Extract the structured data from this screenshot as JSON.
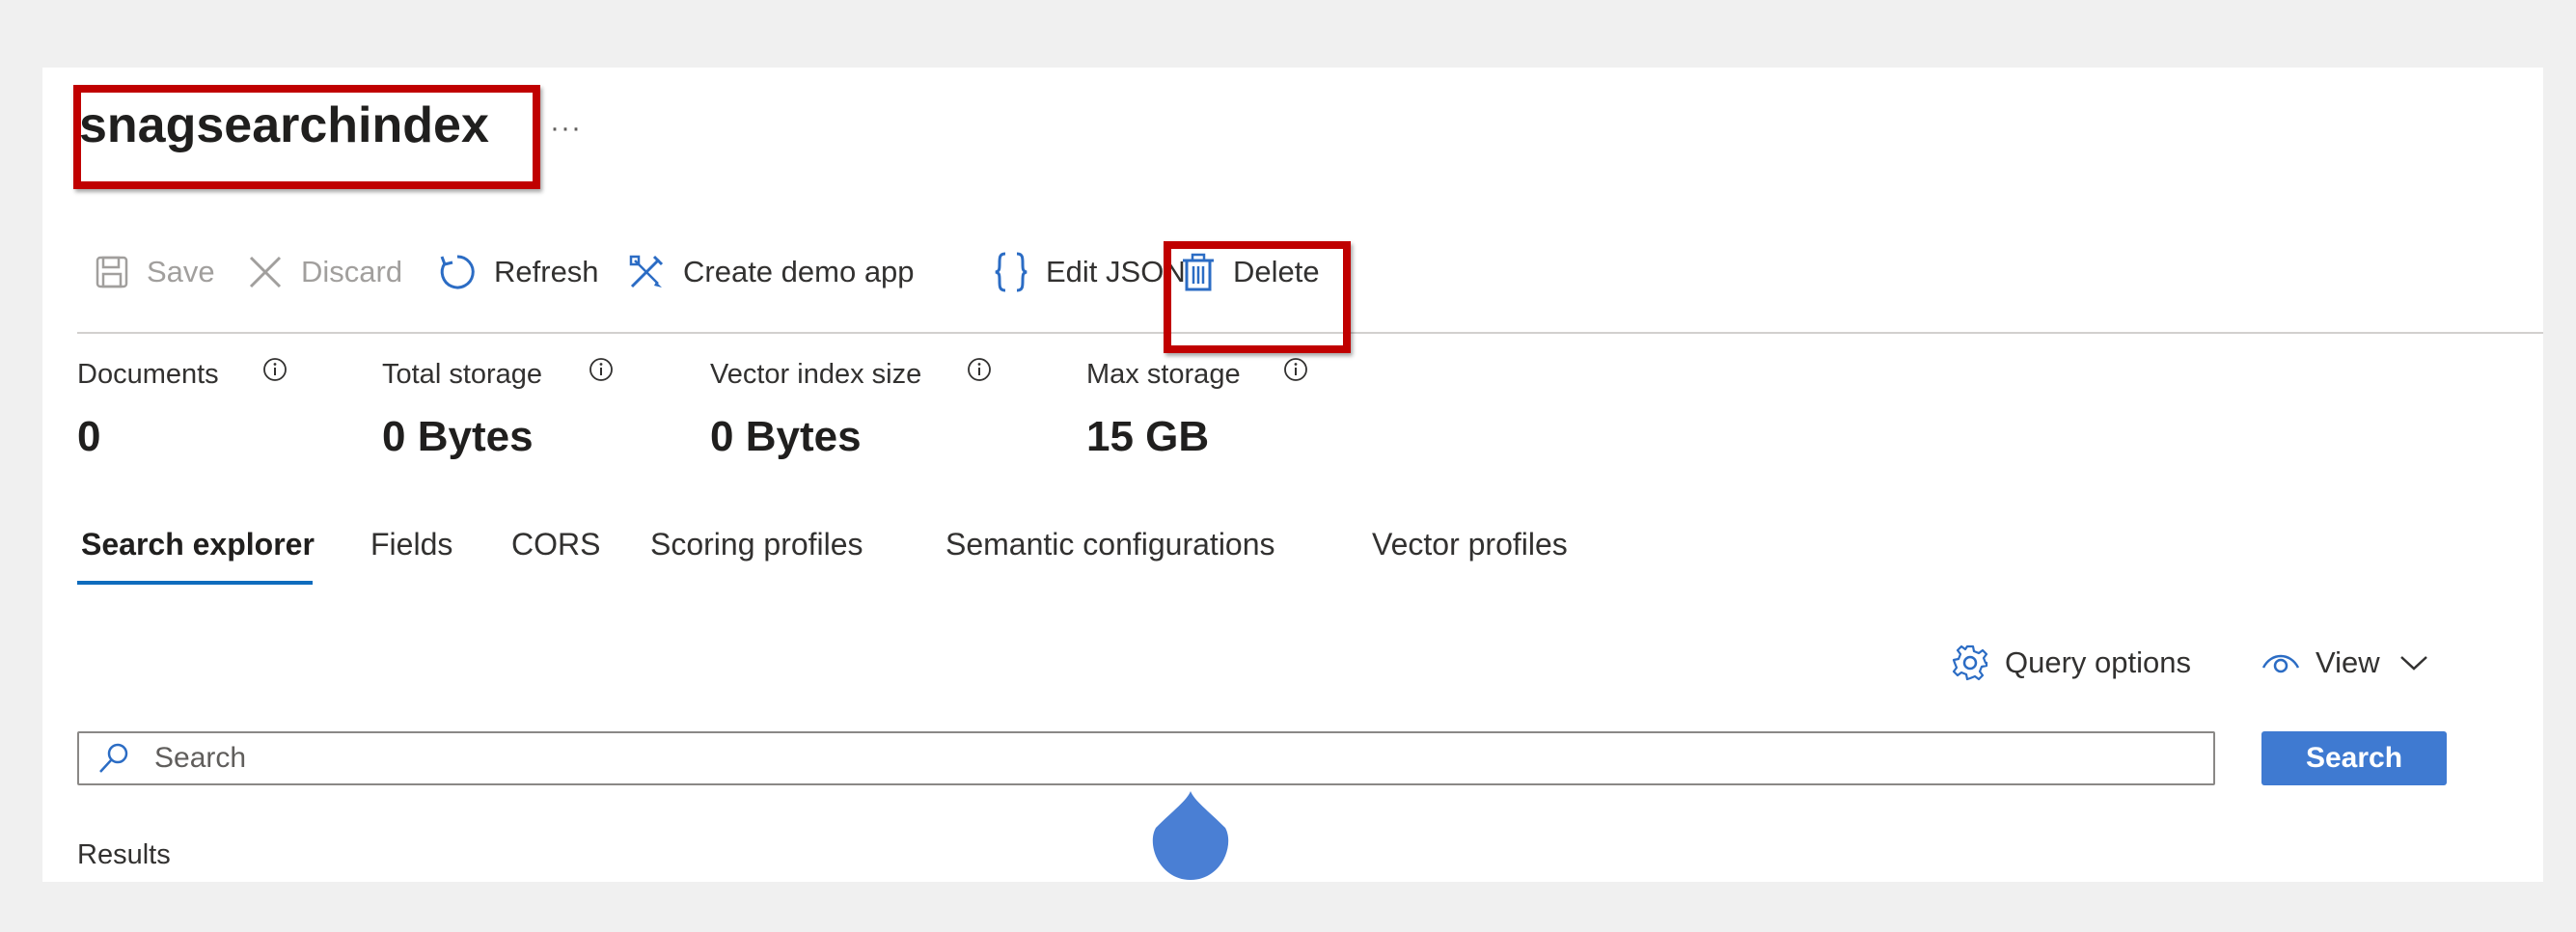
{
  "page": {
    "title": "snagsearchindex",
    "more_label": "···"
  },
  "toolbar": {
    "save_label": "Save",
    "discard_label": "Discard",
    "refresh_label": "Refresh",
    "create_demo_app_label": "Create demo app",
    "edit_json_label": "Edit JSON",
    "delete_label": "Delete"
  },
  "stats": [
    {
      "label": "Documents",
      "value": "0"
    },
    {
      "label": "Total storage",
      "value": "0 Bytes"
    },
    {
      "label": "Vector index size",
      "value": "0 Bytes"
    },
    {
      "label": "Max storage",
      "value": "15 GB"
    }
  ],
  "tabs": [
    {
      "label": "Search explorer",
      "active": true
    },
    {
      "label": "Fields"
    },
    {
      "label": "CORS"
    },
    {
      "label": "Scoring profiles"
    },
    {
      "label": "Semantic configurations"
    },
    {
      "label": "Vector profiles"
    }
  ],
  "explorer": {
    "query_options_label": "Query options",
    "view_label": "View",
    "search_placeholder": "Search",
    "search_button_label": "Search",
    "results_label": "Results"
  },
  "colors": {
    "accent": "#0f6cbd",
    "button_blue": "#3f7ad1",
    "highlight_red": "#c00000",
    "icon_blue": "#2b6cc4"
  },
  "icons": {
    "save": "save-icon",
    "discard": "close-icon",
    "refresh": "refresh-icon",
    "create_demo_app": "create-demo-app-icon",
    "edit_json": "braces-icon",
    "delete": "trash-icon",
    "info": "info-icon",
    "query_options": "gear-icon",
    "view": "eye-icon",
    "chevron": "chevron-down-icon",
    "search": "search-icon"
  }
}
